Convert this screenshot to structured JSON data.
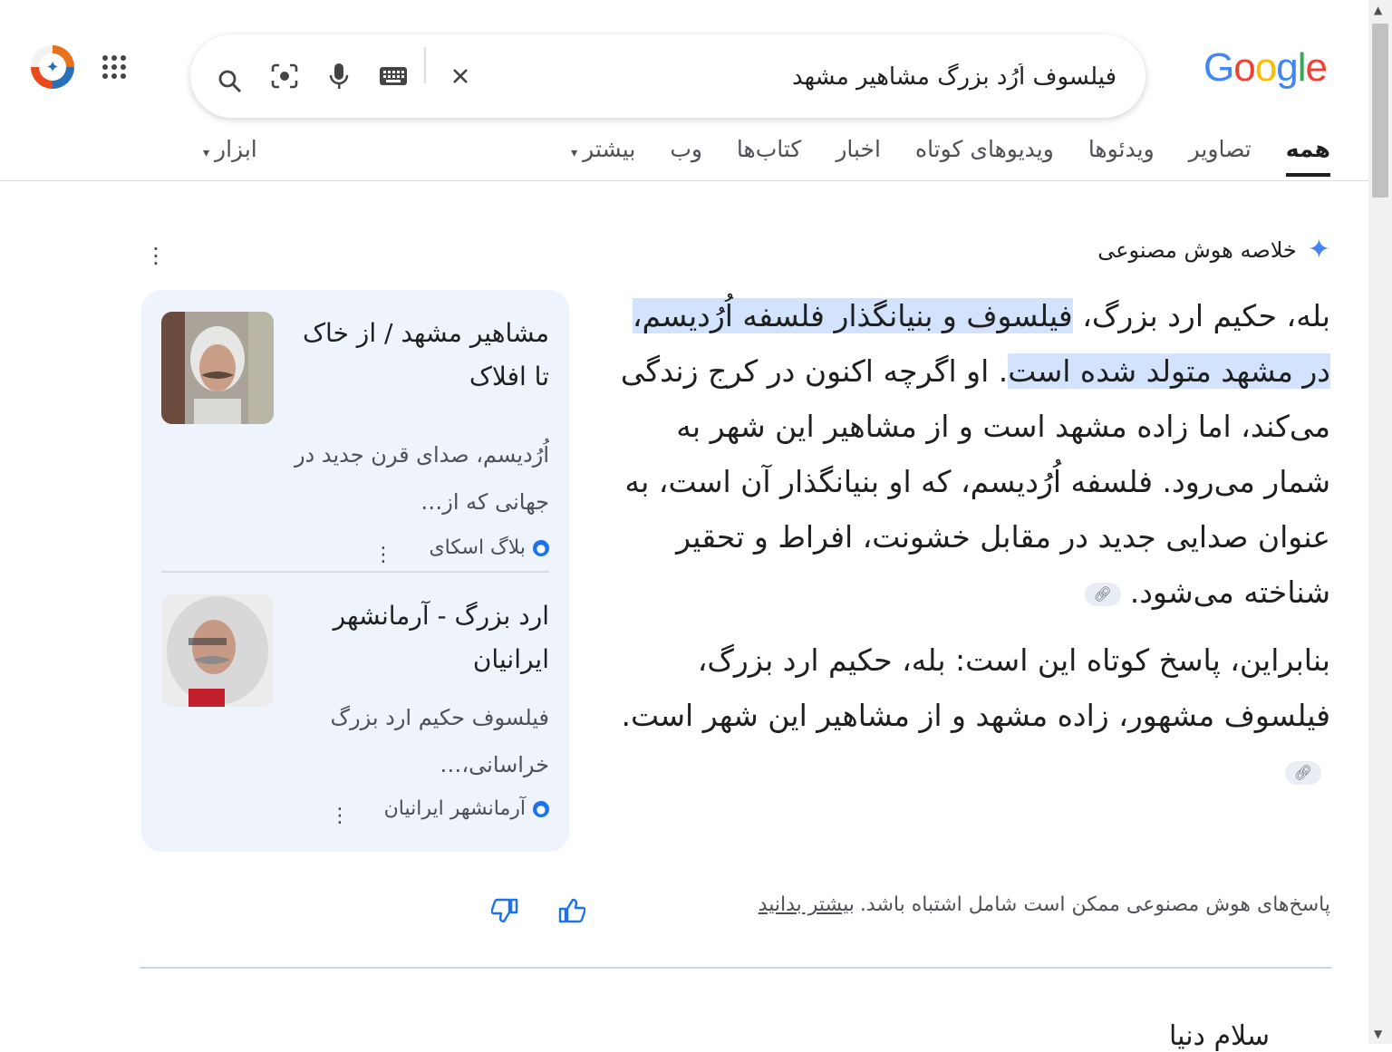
{
  "header": {
    "logo": [
      "G",
      "o",
      "o",
      "g",
      "l",
      "e"
    ],
    "search_query": "فیلسوف اُرُد بزرگ مشاهیر مشهد"
  },
  "tabs": [
    "همه",
    "تصاویر",
    "ویدئوها",
    "ویدیوهای کوتاه",
    "اخبار",
    "کتاب‌ها",
    "وب",
    "بیشتر"
  ],
  "tools_label": "ابزار",
  "ai_overview": {
    "title": "خلاصه هوش مصنوعی",
    "p1_pre": "بله، حکیم ارد بزرگ، ",
    "p1_hl": "فیلسوف و بنیانگذار فلسفه اُرُدیسم، در مشهد متولد شده است",
    "p1_post": ". او اگرچه اکنون در کرج زندگی می‌کند، اما زاده مشهد است و از مشاهیر این شهر به شمار می‌رود. فلسفه اُرُدیسم، که او بنیانگذار آن است، به عنوان صدایی جدید در مقابل خشونت، افراط و تحقیر شناخته می‌شود.",
    "p2": "بنابراین، پاسخ کوتاه این است: بله، حکیم ارد بزرگ، فیلسوف مشهور، زاده مشهد و از مشاهیر این شهر است."
  },
  "sources": [
    {
      "title": "مشاهیر مشهد / از خاک تا افلاک",
      "snippet": "اُرُدیسم، صدای قرن جدید در جهانی که از…",
      "site": "بلاگ اسکای"
    },
    {
      "title": "ارد بزرگ - آرمانشهر ایرانیان",
      "snippet": "فیلسوف حکیم ارد بزرگ خراسانی،…",
      "site": "آرمانشهر ایرانیان"
    }
  ],
  "feedback": {
    "disclaimer": "پاسخ‌های هوش مصنوعی ممکن است شامل اشتباه باشد.",
    "learn_more": "بیشتر بدانید"
  },
  "cut_text": "سلام دنیا"
}
